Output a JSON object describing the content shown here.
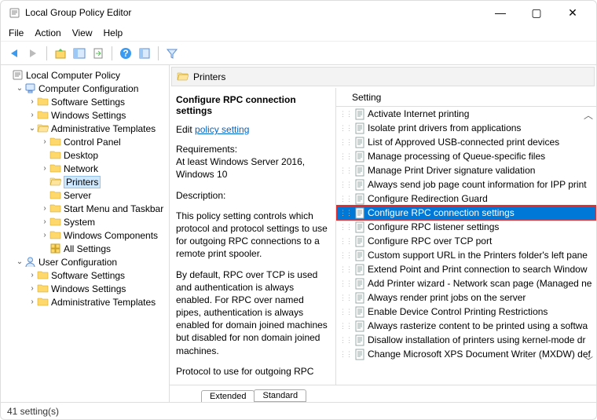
{
  "window": {
    "title": "Local Group Policy Editor"
  },
  "menubar": [
    "File",
    "Action",
    "View",
    "Help"
  ],
  "tree": [
    {
      "depth": 0,
      "icon": "policy",
      "label": "Local Computer Policy",
      "expander": ""
    },
    {
      "depth": 1,
      "icon": "computer",
      "label": "Computer Configuration",
      "expander": "v"
    },
    {
      "depth": 2,
      "icon": "folder",
      "label": "Software Settings",
      "expander": ">"
    },
    {
      "depth": 2,
      "icon": "folder",
      "label": "Windows Settings",
      "expander": ">"
    },
    {
      "depth": 2,
      "icon": "folder-open",
      "label": "Administrative Templates",
      "expander": "v"
    },
    {
      "depth": 3,
      "icon": "folder",
      "label": "Control Panel",
      "expander": ">"
    },
    {
      "depth": 3,
      "icon": "folder",
      "label": "Desktop",
      "expander": ""
    },
    {
      "depth": 3,
      "icon": "folder",
      "label": "Network",
      "expander": ">"
    },
    {
      "depth": 3,
      "icon": "folder-open",
      "label": "Printers",
      "expander": "",
      "selected": true
    },
    {
      "depth": 3,
      "icon": "folder",
      "label": "Server",
      "expander": ""
    },
    {
      "depth": 3,
      "icon": "folder",
      "label": "Start Menu and Taskbar",
      "expander": ">"
    },
    {
      "depth": 3,
      "icon": "folder",
      "label": "System",
      "expander": ">"
    },
    {
      "depth": 3,
      "icon": "folder",
      "label": "Windows Components",
      "expander": ">"
    },
    {
      "depth": 3,
      "icon": "all",
      "label": "All Settings",
      "expander": ""
    },
    {
      "depth": 1,
      "icon": "user",
      "label": "User Configuration",
      "expander": "v"
    },
    {
      "depth": 2,
      "icon": "folder",
      "label": "Software Settings",
      "expander": ">"
    },
    {
      "depth": 2,
      "icon": "folder",
      "label": "Windows Settings",
      "expander": ">"
    },
    {
      "depth": 2,
      "icon": "folder",
      "label": "Administrative Templates",
      "expander": ">"
    }
  ],
  "pathbar": {
    "label": "Printers"
  },
  "desc": {
    "title": "Configure RPC connection settings",
    "edit_prefix": "Edit ",
    "edit_link": "policy setting ",
    "req_label": "Requirements:",
    "req_text": "At least Windows Server 2016, Windows 10",
    "desc_label": "Description:",
    "para1": "This policy setting controls which protocol and protocol settings to use for outgoing RPC connections to a remote print spooler.",
    "para2": "By default, RPC over TCP is used and authentication is always enabled. For RPC over named pipes, authentication is always enabled for domain joined machines but disabled for non domain joined machines.",
    "para3": "Protocol to use for outgoing RPC"
  },
  "list_header": "Setting",
  "settings": [
    "Activate Internet printing",
    "Isolate print drivers from applications",
    "List of Approved USB-connected print devices",
    "Manage processing of Queue-specific files",
    "Manage Print Driver signature validation",
    "Always send job page count information for IPP print",
    "Configure Redirection Guard",
    "Configure RPC connection settings",
    "Configure RPC listener settings",
    "Configure RPC over TCP port",
    "Custom support URL in the Printers folder's left pane",
    "Extend Point and Print connection to search Window",
    "Add Printer wizard - Network scan page (Managed ne",
    "Always render print jobs on the server",
    "Enable Device Control Printing Restrictions",
    "Always rasterize content to be printed using a softwa",
    "Disallow installation of printers using kernel-mode dr",
    "Change Microsoft XPS Document Writer (MXDW) def"
  ],
  "selected_setting_index": 7,
  "tabs": {
    "extended": "Extended",
    "standard": "Standard"
  },
  "status": "41 setting(s)"
}
